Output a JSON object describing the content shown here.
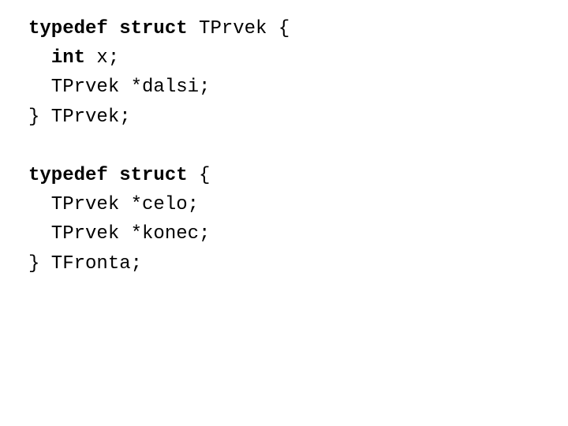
{
  "code": {
    "block1": {
      "l1_kw": "typedef struct",
      "l1_rest": " TPrvek {",
      "l2_indent": "  ",
      "l2_kw": "int",
      "l2_rest": " x;",
      "l3": "  TPrvek *dalsi;",
      "l4": "} TPrvek;"
    },
    "block2": {
      "l1_kw": "typedef struct",
      "l1_rest": " {",
      "l2": "  TPrvek *celo;",
      "l3": "  TPrvek *konec;",
      "l4": "} TFronta;"
    }
  }
}
